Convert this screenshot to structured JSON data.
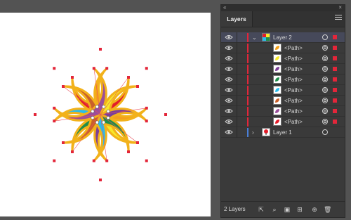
{
  "panel": {
    "title": "Layers",
    "layer_count": "2 Layers"
  },
  "colors": {
    "artboard": "#ffffff",
    "panel_bg": "#3a3a3a",
    "selected_row": "#46495a",
    "layer2_color": "#e3263a",
    "layer1_color": "#4a7fd6",
    "outline": "#f2b21b",
    "anchor": "#e3263a"
  },
  "layers": [
    {
      "label": "Layer 2",
      "type": "layer",
      "expanded": true,
      "selected": true
    },
    {
      "label": "<Path>",
      "type": "path",
      "fill": "#f4a11d"
    },
    {
      "label": "<Path>",
      "type": "path",
      "fill": "#f7e82a"
    },
    {
      "label": "<Path>",
      "type": "path",
      "fill": "#7c3f98"
    },
    {
      "label": "<Path>",
      "type": "path",
      "fill": "#1f8d4a"
    },
    {
      "label": "<Path>",
      "type": "path",
      "fill": "#29bcec"
    },
    {
      "label": "<Path>",
      "type": "path",
      "fill": "#c9602a"
    },
    {
      "label": "<Path>",
      "type": "path",
      "fill": "#9a4e9a"
    },
    {
      "label": "<Path>",
      "type": "path",
      "fill": "#e31d2a"
    },
    {
      "label": "Layer 1",
      "type": "layer",
      "expanded": false,
      "selected": false
    }
  ],
  "artwork": {
    "petals": [
      {
        "name": "red",
        "fill": "#e31d2a"
      },
      {
        "name": "orange",
        "fill": "#f4a11d"
      },
      {
        "name": "yellow",
        "fill": "#f7e82a"
      },
      {
        "name": "purple",
        "fill": "#7c3f98"
      },
      {
        "name": "green",
        "fill": "#1f8d4a"
      },
      {
        "name": "cyan",
        "fill": "#29bcec"
      },
      {
        "name": "brown",
        "fill": "#c9602a"
      },
      {
        "name": "magenta",
        "fill": "#9a4e9a"
      }
    ]
  },
  "icons": {
    "visibility": "eye-icon",
    "collapse": "double-arrow-icon",
    "close": "close-icon",
    "menu": "panel-menu-icon",
    "export": "export-icon",
    "search": "locate-object-icon",
    "clip": "clipping-mask-icon",
    "sublayer": "new-sublayer-icon",
    "newlayer": "new-layer-icon",
    "delete": "trash-icon"
  }
}
